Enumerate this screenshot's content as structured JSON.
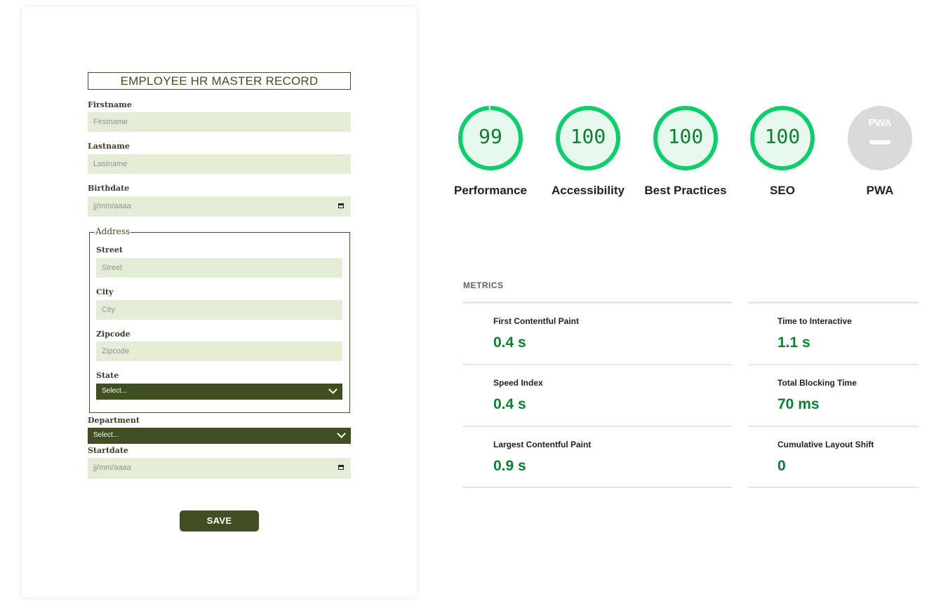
{
  "form": {
    "title": "EMPLOYEE HR MASTER RECORD",
    "firstname_label": "Firstname",
    "firstname_placeholder": "Firstname",
    "lastname_label": "Lastname",
    "lastname_placeholder": "Lastname",
    "birthdate_label": "Birthdate",
    "birthdate_placeholder": "jj/mm/aaaa",
    "address_legend": "Address",
    "street_label": "Street",
    "street_placeholder": "Street",
    "city_label": "City",
    "city_placeholder": "City",
    "zipcode_label": "Zipcode",
    "zipcode_placeholder": "Zipcode",
    "state_label": "State",
    "state_value": "Select...",
    "department_label": "Department",
    "department_value": "Select...",
    "startdate_label": "Startdate",
    "startdate_placeholder": "jj/mm/aaaa",
    "save_label": "SAVE"
  },
  "scores": [
    {
      "value": "99",
      "label": "Performance",
      "fraction": 0.99
    },
    {
      "value": "100",
      "label": "Accessibility",
      "fraction": 1.0
    },
    {
      "value": "100",
      "label": "Best Practices",
      "fraction": 1.0
    },
    {
      "value": "100",
      "label": "SEO",
      "fraction": 1.0
    }
  ],
  "pwa": {
    "badge": "PWA",
    "label": "PWA"
  },
  "metrics": {
    "title": "METRICS",
    "items": [
      {
        "label": "First Contentful Paint",
        "value": "0.4 s"
      },
      {
        "label": "Time to Interactive",
        "value": "1.1 s"
      },
      {
        "label": "Speed Index",
        "value": "0.4 s"
      },
      {
        "label": "Total Blocking Time",
        "value": "70 ms"
      },
      {
        "label": "Largest Contentful Paint",
        "value": "0.9 s"
      },
      {
        "label": "Cumulative Layout Shift",
        "value": "0"
      }
    ]
  },
  "colors": {
    "form_accent": "#3f4f22",
    "input_bg": "#e4ecd8",
    "score_pass": "#0cce6b",
    "score_text": "#0c7f32",
    "pwa_gray": "#dadada"
  }
}
